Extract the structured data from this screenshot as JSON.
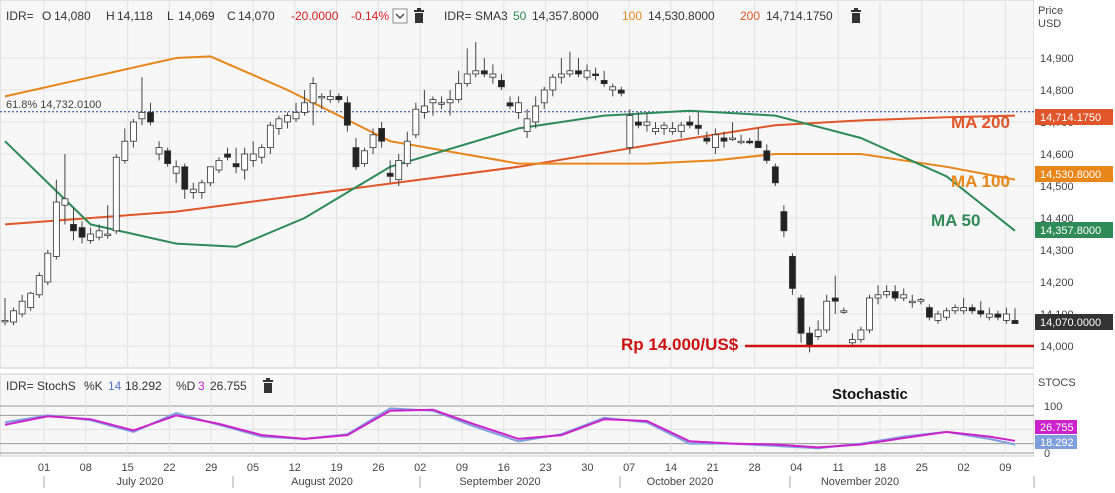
{
  "colors": {
    "up": "#ffffff",
    "down": "#222222",
    "wick": "#444444",
    "ma50": "#2e8b57",
    "ma100": "#e8861a",
    "ma200": "#e0552a",
    "support": "#cc1111",
    "fib": "#1f3fa6",
    "stochK": "#7f9fdc",
    "stochD": "#cc22cc"
  },
  "header": {
    "symbol": "IDR=",
    "open_label": "O",
    "open": "14,080",
    "high_label": "H",
    "high": "14,118",
    "low_label": "L",
    "low": "14,069",
    "close_label": "C",
    "close": "14,070",
    "change": "-20.0000",
    "change_pct": "-0.14%",
    "sma_label": "IDR= SMA3",
    "sma50_period": "50",
    "sma50_value": "14,357.8000",
    "sma100_period": "100",
    "sma100_value": "14,530.8000",
    "sma200_period": "200",
    "sma200_value": "14,714.1750"
  },
  "lower_header": {
    "label": "IDR= StochS",
    "k_label": "%K",
    "k_period": "14",
    "k_value": "18.292",
    "d_label": "%D",
    "d_period": "3",
    "d_value": "26.755"
  },
  "axis": {
    "price_title_1": "Price",
    "price_title_2": "USD",
    "stoch_title": "STOCS",
    "price_ticks": [
      "14,900",
      "14,800",
      "14,700",
      "14,600",
      "14,500",
      "14,400",
      "14,300",
      "14,200",
      "14,100",
      "14,000"
    ],
    "stoch_ticks": [
      "100",
      "50",
      "0"
    ],
    "days": [
      "01",
      "08",
      "15",
      "22",
      "29",
      "05",
      "12",
      "19",
      "26",
      "02",
      "09",
      "16",
      "23",
      "30",
      "07",
      "14",
      "21",
      "28",
      "04",
      "11",
      "18",
      "25",
      "02",
      "09"
    ],
    "months": [
      "July 2020",
      "August 2020",
      "September 2020",
      "October 2020",
      "November 2020"
    ]
  },
  "tags": {
    "ma200": "14,714.1750",
    "ma100": "14,530.8000",
    "ma50": "14,357.8000",
    "last": "14,070.0000",
    "k": "18.292",
    "d": "26.755"
  },
  "annotations": {
    "fib": "61.8% 14,732.0100",
    "ma200": "MA 200",
    "ma100": "MA 100",
    "ma50": "MA 50",
    "support": "Rp 14.000/US$",
    "stochastic": "Stochastic"
  },
  "chart_data": {
    "type": "candlestick",
    "y_range": [
      13980,
      14960
    ],
    "stoch_range": [
      0,
      100
    ],
    "fib_level": 14732.01,
    "support_level": 14000,
    "candles": [
      [
        14080,
        14150,
        14065,
        14080
      ],
      [
        14075,
        14120,
        14065,
        14110
      ],
      [
        14100,
        14160,
        14090,
        14140
      ],
      [
        14120,
        14170,
        14110,
        14165
      ],
      [
        14160,
        14230,
        14150,
        14220
      ],
      [
        14200,
        14300,
        14190,
        14290
      ],
      [
        14280,
        14520,
        14270,
        14450
      ],
      [
        14440,
        14600,
        14380,
        14460
      ],
      [
        14380,
        14430,
        14330,
        14360
      ],
      [
        14370,
        14390,
        14320,
        14340
      ],
      [
        14330,
        14370,
        14320,
        14350
      ],
      [
        14340,
        14380,
        14330,
        14360
      ],
      [
        14345,
        14440,
        14335,
        14350
      ],
      [
        14360,
        14600,
        14350,
        14590
      ],
      [
        14580,
        14680,
        14570,
        14640
      ],
      [
        14640,
        14710,
        14620,
        14700
      ],
      [
        14710,
        14840,
        14690,
        14730
      ],
      [
        14730,
        14760,
        14690,
        14700
      ],
      [
        14600,
        14640,
        14580,
        14620
      ],
      [
        14610,
        14620,
        14560,
        14570
      ],
      [
        14540,
        14580,
        14510,
        14560
      ],
      [
        14560,
        14570,
        14460,
        14490
      ],
      [
        14480,
        14510,
        14460,
        14490
      ],
      [
        14480,
        14520,
        14460,
        14510
      ],
      [
        14510,
        14560,
        14500,
        14560
      ],
      [
        14550,
        14590,
        14540,
        14580
      ],
      [
        14600,
        14620,
        14580,
        14590
      ],
      [
        14570,
        14620,
        14540,
        14560
      ],
      [
        14550,
        14620,
        14520,
        14600
      ],
      [
        14580,
        14640,
        14560,
        14600
      ],
      [
        14590,
        14630,
        14570,
        14620
      ],
      [
        14620,
        14700,
        14600,
        14690
      ],
      [
        14680,
        14720,
        14660,
        14710
      ],
      [
        14700,
        14730,
        14680,
        14720
      ],
      [
        14710,
        14760,
        14700,
        14730
      ],
      [
        14730,
        14800,
        14720,
        14760
      ],
      [
        14760,
        14840,
        14690,
        14820
      ],
      [
        14780,
        14790,
        14740,
        14780
      ],
      [
        14770,
        14800,
        14760,
        14780
      ],
      [
        14780,
        14790,
        14760,
        14770
      ],
      [
        14760,
        14780,
        14670,
        14690
      ],
      [
        14620,
        14650,
        14550,
        14560
      ],
      [
        14570,
        14620,
        14560,
        14610
      ],
      [
        14620,
        14680,
        14600,
        14660
      ],
      [
        14680,
        14700,
        14620,
        14640
      ],
      [
        14540,
        14580,
        14510,
        14530
      ],
      [
        14520,
        14600,
        14500,
        14580
      ],
      [
        14570,
        14670,
        14560,
        14640
      ],
      [
        14660,
        14760,
        14650,
        14740
      ],
      [
        14730,
        14800,
        14710,
        14750
      ],
      [
        14760,
        14780,
        14720,
        14770
      ],
      [
        14760,
        14780,
        14740,
        14760
      ],
      [
        14760,
        14800,
        14720,
        14770
      ],
      [
        14770,
        14860,
        14760,
        14820
      ],
      [
        14820,
        14930,
        14810,
        14850
      ],
      [
        14850,
        14950,
        14840,
        14860
      ],
      [
        14860,
        14900,
        14840,
        14850
      ],
      [
        14840,
        14880,
        14820,
        14850
      ],
      [
        14830,
        14850,
        14800,
        14810
      ],
      [
        14760,
        14780,
        14740,
        14750
      ],
      [
        14730,
        14780,
        14710,
        14760
      ],
      [
        14670,
        14740,
        14650,
        14710
      ],
      [
        14700,
        14780,
        14680,
        14750
      ],
      [
        14760,
        14810,
        14740,
        14800
      ],
      [
        14800,
        14850,
        14780,
        14840
      ],
      [
        14840,
        14900,
        14820,
        14850
      ],
      [
        14850,
        14920,
        14840,
        14860
      ],
      [
        14860,
        14900,
        14840,
        14850
      ],
      [
        14840,
        14880,
        14830,
        14860
      ],
      [
        14850,
        14870,
        14830,
        14845
      ],
      [
        14830,
        14860,
        14810,
        14820
      ],
      [
        14800,
        14820,
        14780,
        14810
      ],
      [
        14800,
        14810,
        14780,
        14790
      ],
      [
        14620,
        14740,
        14600,
        14720
      ],
      [
        14700,
        14730,
        14680,
        14690
      ],
      [
        14690,
        14730,
        14670,
        14700
      ],
      [
        14670,
        14700,
        14660,
        14680
      ],
      [
        14680,
        14700,
        14660,
        14690
      ],
      [
        14670,
        14700,
        14660,
        14680
      ],
      [
        14670,
        14700,
        14650,
        14690
      ],
      [
        14700,
        14720,
        14680,
        14690
      ],
      [
        14690,
        14730,
        14660,
        14680
      ],
      [
        14650,
        14670,
        14630,
        14640
      ],
      [
        14620,
        14680,
        14600,
        14660
      ],
      [
        14650,
        14670,
        14620,
        14640
      ],
      [
        14650,
        14700,
        14640,
        14650
      ],
      [
        14640,
        14660,
        14630,
        14640
      ],
      [
        14640,
        14650,
        14630,
        14635
      ],
      [
        14640,
        14680,
        14620,
        14620
      ],
      [
        14610,
        14630,
        14570,
        14580
      ],
      [
        14560,
        14570,
        14500,
        14510
      ],
      [
        14420,
        14440,
        14340,
        14360
      ],
      [
        14280,
        14290,
        14160,
        14180
      ],
      [
        14150,
        14160,
        14010,
        14040
      ],
      [
        14040,
        14060,
        13980,
        14000
      ],
      [
        14030,
        14080,
        14020,
        14050
      ],
      [
        14050,
        14160,
        14040,
        14140
      ],
      [
        14150,
        14220,
        14100,
        14140
      ],
      [
        14110,
        14120,
        14100,
        14110
      ],
      [
        14010,
        14040,
        14000,
        14020
      ],
      [
        14020,
        14060,
        14010,
        14050
      ],
      [
        14050,
        14160,
        14040,
        14150
      ],
      [
        14150,
        14190,
        14130,
        14160
      ],
      [
        14160,
        14190,
        14150,
        14170
      ],
      [
        14170,
        14190,
        14140,
        14150
      ],
      [
        14150,
        14180,
        14140,
        14160
      ],
      [
        14140,
        14160,
        14120,
        14140
      ],
      [
        14140,
        14150,
        14130,
        14145
      ],
      [
        14120,
        14130,
        14080,
        14090
      ],
      [
        14080,
        14110,
        14070,
        14100
      ],
      [
        14090,
        14120,
        14080,
        14110
      ],
      [
        14110,
        14130,
        14100,
        14120
      ],
      [
        14110,
        14150,
        14100,
        14120
      ],
      [
        14120,
        14130,
        14100,
        14110
      ],
      [
        14110,
        14140,
        14090,
        14100
      ],
      [
        14090,
        14120,
        14080,
        14100
      ],
      [
        14100,
        14110,
        14080,
        14090
      ],
      [
        14080,
        14120,
        14070,
        14100
      ],
      [
        14080,
        14118,
        14069,
        14070
      ]
    ],
    "ma50": [
      [
        0,
        14640
      ],
      [
        10,
        14380
      ],
      [
        20,
        14320
      ],
      [
        27,
        14310
      ],
      [
        35,
        14400
      ],
      [
        45,
        14560
      ],
      [
        60,
        14680
      ],
      [
        70,
        14720
      ],
      [
        80,
        14735
      ],
      [
        90,
        14720
      ],
      [
        100,
        14650
      ],
      [
        110,
        14530
      ],
      [
        118,
        14360
      ]
    ],
    "ma100": [
      [
        0,
        14780
      ],
      [
        10,
        14840
      ],
      [
        20,
        14900
      ],
      [
        24,
        14905
      ],
      [
        33,
        14800
      ],
      [
        45,
        14640
      ],
      [
        60,
        14570
      ],
      [
        75,
        14570
      ],
      [
        83,
        14580
      ],
      [
        90,
        14600
      ],
      [
        100,
        14600
      ],
      [
        110,
        14560
      ],
      [
        118,
        14520
      ]
    ],
    "ma200": [
      [
        0,
        14380
      ],
      [
        20,
        14420
      ],
      [
        40,
        14490
      ],
      [
        60,
        14560
      ],
      [
        78,
        14640
      ],
      [
        90,
        14690
      ],
      [
        100,
        14705
      ],
      [
        110,
        14715
      ],
      [
        118,
        14720
      ]
    ],
    "stoch_k": [
      [
        0,
        65
      ],
      [
        5,
        80
      ],
      [
        10,
        70
      ],
      [
        15,
        45
      ],
      [
        20,
        85
      ],
      [
        25,
        60
      ],
      [
        30,
        35
      ],
      [
        35,
        30
      ],
      [
        40,
        40
      ],
      [
        45,
        95
      ],
      [
        50,
        90
      ],
      [
        55,
        55
      ],
      [
        60,
        25
      ],
      [
        65,
        40
      ],
      [
        70,
        75
      ],
      [
        75,
        65
      ],
      [
        80,
        20
      ],
      [
        85,
        20
      ],
      [
        90,
        15
      ],
      [
        95,
        10
      ],
      [
        100,
        20
      ],
      [
        105,
        35
      ],
      [
        110,
        45
      ],
      [
        115,
        30
      ],
      [
        118,
        18
      ]
    ],
    "stoch_d": [
      [
        0,
        60
      ],
      [
        5,
        78
      ],
      [
        10,
        72
      ],
      [
        15,
        48
      ],
      [
        20,
        80
      ],
      [
        25,
        62
      ],
      [
        30,
        38
      ],
      [
        35,
        30
      ],
      [
        40,
        38
      ],
      [
        45,
        90
      ],
      [
        50,
        92
      ],
      [
        55,
        60
      ],
      [
        60,
        30
      ],
      [
        65,
        38
      ],
      [
        70,
        72
      ],
      [
        75,
        68
      ],
      [
        80,
        25
      ],
      [
        85,
        20
      ],
      [
        90,
        18
      ],
      [
        95,
        12
      ],
      [
        100,
        18
      ],
      [
        105,
        32
      ],
      [
        110,
        45
      ],
      [
        115,
        35
      ],
      [
        118,
        26
      ]
    ]
  }
}
